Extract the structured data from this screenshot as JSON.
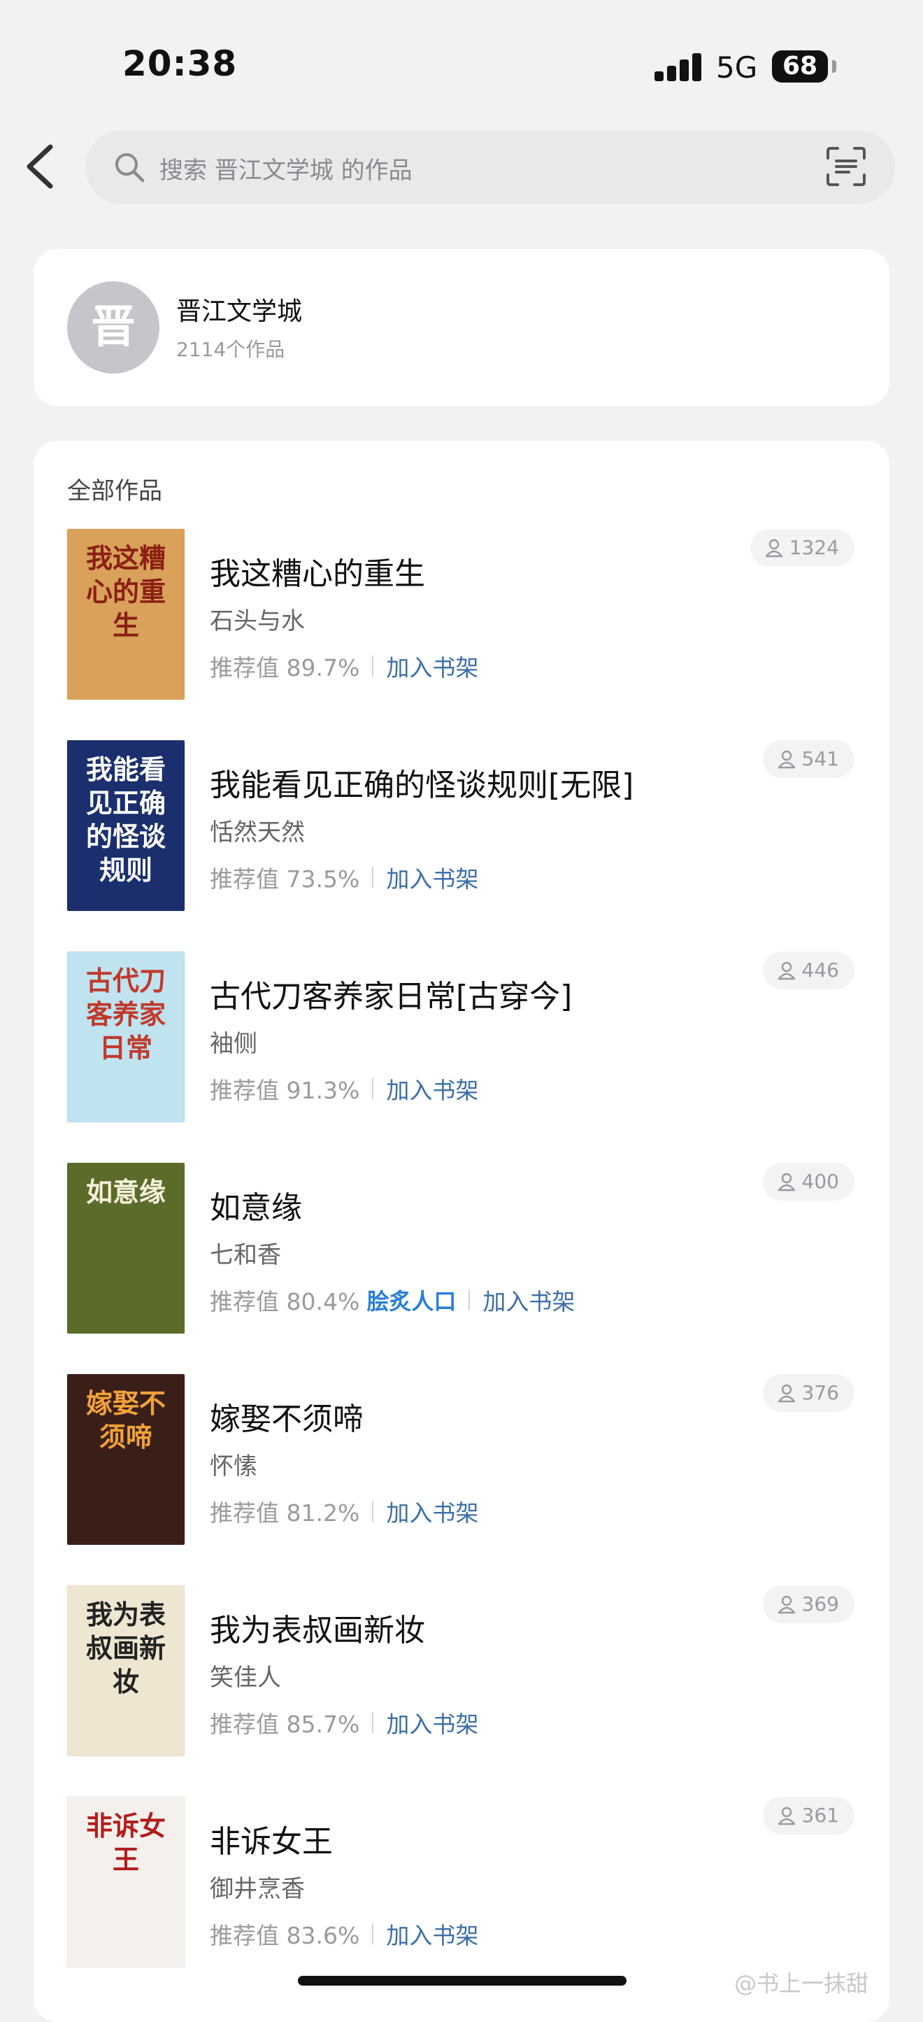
{
  "status": {
    "time": "20:38",
    "network": "5G",
    "battery": "68"
  },
  "search": {
    "placeholder": "搜索 晋江文学城 的作品"
  },
  "publisher": {
    "avatar_text": "晋",
    "name": "晋江文学城",
    "count": "2114个作品"
  },
  "section_title": "全部作品",
  "books": [
    {
      "title": "我这糟心的重生",
      "author": "石头与水",
      "rec": "推荐值 89.7%",
      "add": "加入书架",
      "reads": "1324",
      "cover_text": "我这糟心的重生",
      "cover_bg": "#d9a15a",
      "cover_fg": "#8a1f12"
    },
    {
      "title": "我能看见正确的怪谈规则[无限]",
      "author": "恬然天然",
      "rec": "推荐值 73.5%",
      "add": "加入书架",
      "reads": "541",
      "cover_text": "我能看见正确的怪谈规则",
      "cover_bg": "#1b2f6e",
      "cover_fg": "#ffffff"
    },
    {
      "title": "古代刀客养家日常[古穿今]",
      "author": "袖侧",
      "rec": "推荐值 91.3%",
      "add": "加入书架",
      "reads": "446",
      "cover_text": "古代刀客养家日常",
      "cover_bg": "#bfe3ef",
      "cover_fg": "#c0392b"
    },
    {
      "title": "如意缘",
      "author": "七和香",
      "rec": "推荐值 80.4%",
      "badge": "脍炙人口",
      "add": "加入书架",
      "reads": "400",
      "cover_text": "如意缘",
      "cover_bg": "#5b6b2a",
      "cover_fg": "#f3f0d8"
    },
    {
      "title": "嫁娶不须啼",
      "author": "怀愫",
      "rec": "推荐值 81.2%",
      "add": "加入书架",
      "reads": "376",
      "cover_text": "嫁娶不须啼",
      "cover_bg": "#3a1f18",
      "cover_fg": "#f0a23a"
    },
    {
      "title": "我为表叔画新妆",
      "author": "笑佳人",
      "rec": "推荐值 85.7%",
      "add": "加入书架",
      "reads": "369",
      "cover_text": "我为表叔画新妆",
      "cover_bg": "#efe6d2",
      "cover_fg": "#222222"
    },
    {
      "title": "非诉女王",
      "author": "御井烹香",
      "rec": "推荐值 83.6%",
      "add": "加入书架",
      "reads": "361",
      "cover_text": "非诉女王",
      "cover_bg": "#f4f1ec",
      "cover_fg": "#b11d1d"
    }
  ],
  "watermark": "@书上一抹甜"
}
